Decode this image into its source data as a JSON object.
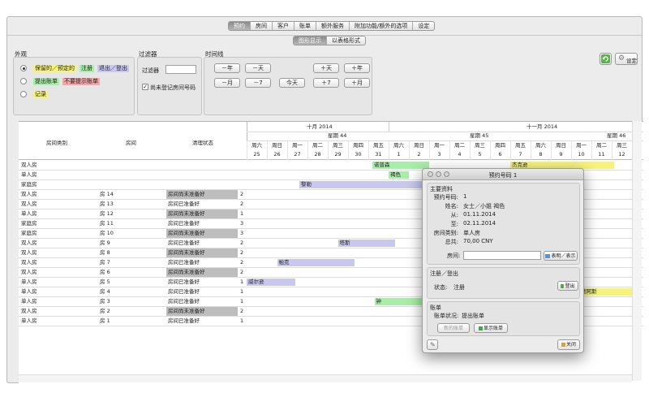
{
  "tabs": [
    {
      "label": "预约",
      "active": true
    },
    {
      "label": "房间",
      "active": false
    },
    {
      "label": "客户",
      "active": false
    },
    {
      "label": "账单",
      "active": false
    },
    {
      "label": "额外服务",
      "active": false
    },
    {
      "label": "附加功能/额外的选项",
      "active": false
    },
    {
      "label": "设定",
      "active": false
    }
  ],
  "view_toggle": [
    {
      "label": "图形显示",
      "active": true
    },
    {
      "label": "以表格形式",
      "active": false
    }
  ],
  "appearance": {
    "title": "外观",
    "options": [
      {
        "tags": [
          {
            "text": "保留的／预定的",
            "color": "#f6f27a"
          },
          {
            "text": "注册",
            "color": "#a8eda8"
          },
          {
            "text": "退出／登出",
            "color": "#c8c8ee"
          }
        ],
        "selected": true
      },
      {
        "tags": [
          {
            "text": "提出账单",
            "color": "#a8eda8"
          },
          {
            "text": "不要提示账单",
            "color": "#f4a5a5"
          }
        ],
        "selected": false
      },
      {
        "tags": [
          {
            "text": "记录",
            "color": "#f6f27a"
          }
        ],
        "selected": false
      }
    ]
  },
  "filter": {
    "title": "过滤器",
    "label": "过滤器",
    "value": "",
    "checkbox_label": "尚未登记房间号码",
    "checked": true
  },
  "timeline": {
    "title": "时间线",
    "buttons_row1": [
      "－年",
      "－天",
      "＋天",
      "＋年"
    ],
    "buttons_row2": [
      "－月",
      "－7",
      "今天",
      "＋7",
      "＋月"
    ]
  },
  "toolbar": {
    "settings_label": "设定",
    "refresh_icon": "refresh-icon",
    "gear_icon": "gear-icon"
  },
  "grid": {
    "headers": {
      "room_type": "房间类别",
      "room": "房间",
      "cleaning": "清理状态"
    },
    "months": [
      "十月 2014",
      "十一月 2014"
    ],
    "weeks": [
      "星期 44",
      "星期 45",
      "星期 46"
    ],
    "weekdays": [
      "周六",
      "周日",
      "周一",
      "周二",
      "周三",
      "周四",
      "周五",
      "周六",
      "周日",
      "周一",
      "周二",
      "周三",
      "周四",
      "周五",
      "周六",
      "周日",
      "周一",
      "周二",
      "周三"
    ],
    "dates": [
      "25",
      "26",
      "27",
      "28",
      "29",
      "30",
      "31",
      "1",
      "2",
      "3",
      "4",
      "5",
      "6",
      "7",
      "8",
      "9",
      "10",
      "11",
      "12"
    ],
    "rows": [
      {
        "type": "双人房",
        "room": "",
        "status": "",
        "status_dirty": false,
        "count": ""
      },
      {
        "type": "单人房",
        "room": "",
        "status": "",
        "status_dirty": false,
        "count": ""
      },
      {
        "type": "家庭房",
        "room": "",
        "status": "",
        "status_dirty": false,
        "count": ""
      },
      {
        "type": "双人房",
        "room": "房 14",
        "status": "房间尚未准备好",
        "status_dirty": true,
        "count": "2"
      },
      {
        "type": "双人房",
        "room": "房 13",
        "status": "房间已准备好",
        "status_dirty": false,
        "count": "2"
      },
      {
        "type": "单人房",
        "room": "房 12",
        "status": "房间尚未准备好",
        "status_dirty": true,
        "count": "1"
      },
      {
        "type": "家庭房",
        "room": "房 11",
        "status": "房间已准备好",
        "status_dirty": false,
        "count": "3"
      },
      {
        "type": "家庭房",
        "room": "房 10",
        "status": "房间尚未准备好",
        "status_dirty": true,
        "count": "3"
      },
      {
        "type": "双人房",
        "room": "房 9",
        "status": "房间已准备好",
        "status_dirty": false,
        "count": "2"
      },
      {
        "type": "双人房",
        "room": "房 8",
        "status": "房间尚未准备好",
        "status_dirty": true,
        "count": "2"
      },
      {
        "type": "双人房",
        "room": "房 7",
        "status": "房间已准备好",
        "status_dirty": false,
        "count": "2"
      },
      {
        "type": "双人房",
        "room": "房 6",
        "status": "房间尚未准备好",
        "status_dirty": true,
        "count": "2"
      },
      {
        "type": "单人房",
        "room": "房 5",
        "status": "房间已准备好",
        "status_dirty": false,
        "count": "1"
      },
      {
        "type": "单人房",
        "room": "房 4",
        "status": "房间已准备好",
        "status_dirty": false,
        "count": "1"
      },
      {
        "type": "单人房",
        "room": "房 3",
        "status": "房间已准备好",
        "status_dirty": false,
        "count": "1"
      },
      {
        "type": "双人房",
        "room": "房 2",
        "status": "房间尚未准备好",
        "status_dirty": true,
        "count": "2"
      },
      {
        "type": "单人房",
        "room": "房 1",
        "status": "房间已准备好",
        "status_dirty": false,
        "count": "1"
      }
    ],
    "bookings": [
      {
        "row": 0,
        "start": 6.2,
        "end": 9,
        "label": "诺普森",
        "color": "#a8eda8"
      },
      {
        "row": 0,
        "start": 13,
        "end": 18.1,
        "label": "杰克逊",
        "color": "#f6f27a"
      },
      {
        "row": 1,
        "start": 7,
        "end": 8,
        "label": "褐色",
        "color": "#a8eda8"
      },
      {
        "row": 2,
        "start": 2.6,
        "end": 9,
        "label": "黎勒",
        "color": "#c8c8ee"
      },
      {
        "row": 8,
        "start": 4.5,
        "end": 7.3,
        "label": "塔斯",
        "color": "#c8c8ee"
      },
      {
        "row": 10,
        "start": 1.5,
        "end": 5.3,
        "label": "帕克",
        "color": "#c8c8ee"
      },
      {
        "row": 12,
        "start": 0,
        "end": 2.4,
        "label": "威尔逊",
        "color": "#c8c8ee"
      },
      {
        "row": 13,
        "start": 16.4,
        "end": 19,
        "label": "德阿斯",
        "color": "#f6f27a"
      },
      {
        "row": 14,
        "start": 6.3,
        "end": 9.8,
        "label": "钟",
        "color": "#a8eda8"
      }
    ]
  },
  "dialog": {
    "title": "预约号码 1",
    "main_section": "主要资料",
    "fields": [
      {
        "label": "预约号码:",
        "value": "1"
      },
      {
        "label": "姓名:",
        "value": "女士／小姐 褐色"
      },
      {
        "label": "从:",
        "value": "01.11.2014"
      },
      {
        "label": "至:",
        "value": "02.11.2014"
      },
      {
        "label": "房间类别:",
        "value": "单人房"
      },
      {
        "label": "总共:",
        "value": "70,00 CNY"
      }
    ],
    "room_label": "房间:",
    "room_value": "",
    "show_button": "表明／表示",
    "checkin_section": "注册／登出",
    "status_label": "状态:",
    "status_value": "注册",
    "checkout_button": "登出",
    "bill_section": "账单",
    "bill_status_label": "账单状况:",
    "bill_status_value": "提出账单",
    "new_bill_button": "新的账单",
    "show_bill_button": "显示账单",
    "close_button": "关闭"
  }
}
